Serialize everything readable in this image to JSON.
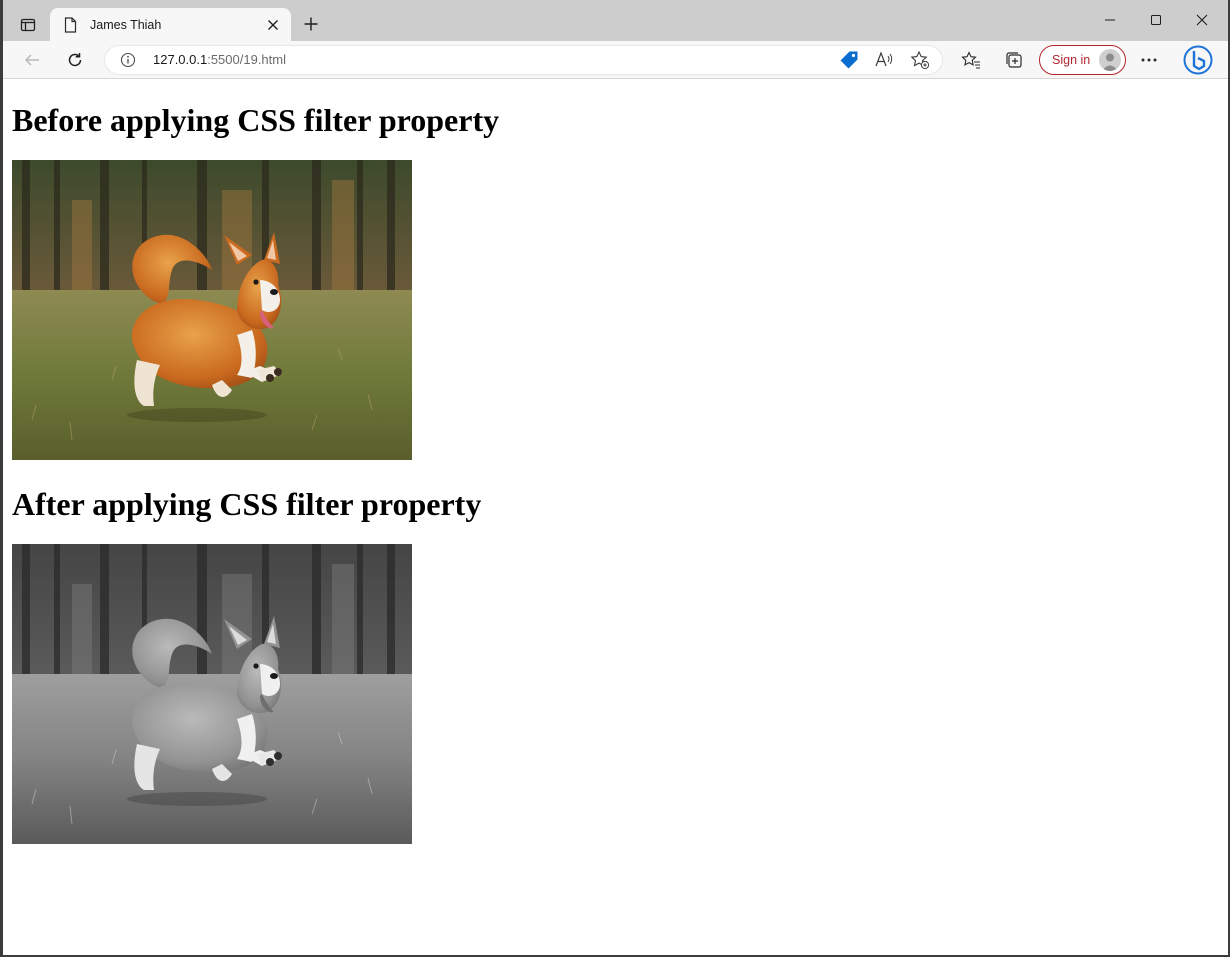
{
  "browser": {
    "tab_title": "James Thiah",
    "url_host": "127.0.0.1",
    "url_path": ":5500/19.html",
    "sign_in_label": "Sign in",
    "accent_color": "#b3262f"
  },
  "page": {
    "heading_before": "Before applying CSS filter property",
    "heading_after": "After applying CSS filter property",
    "image_subject": "corgi-running-in-grass",
    "filter_applied": "grayscale"
  },
  "icons": {
    "tab_actions": "tab-actions-icon",
    "page": "page-icon",
    "close": "close-icon",
    "new_tab": "plus-icon",
    "minimize": "minimize-icon",
    "maximize": "maximize-icon",
    "close_window": "close-window-icon",
    "back": "back-arrow-icon",
    "refresh": "refresh-icon",
    "info": "info-icon",
    "shopping_tag": "tag-icon",
    "read_aloud": "read-aloud-icon",
    "add_favorite": "add-favorite-icon",
    "favorites": "favorites-icon",
    "collections": "collections-icon",
    "more": "more-icon",
    "copilot": "bing-copilot-icon"
  }
}
